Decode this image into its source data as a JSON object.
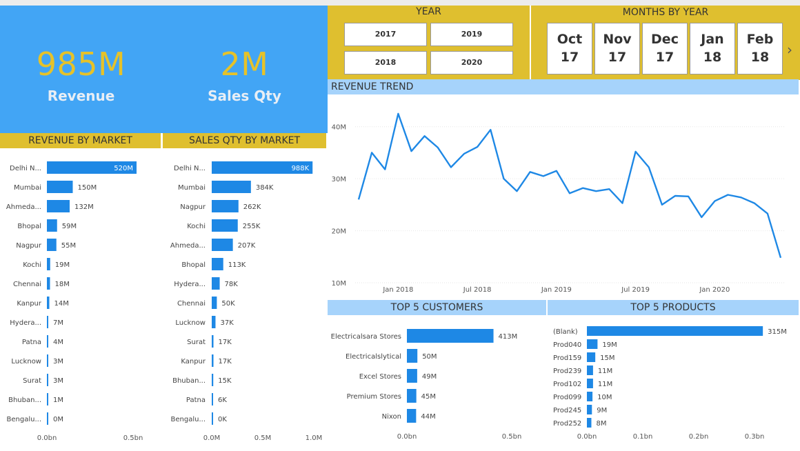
{
  "kpi": [
    {
      "value": "985M",
      "label": "Revenue"
    },
    {
      "value": "2M",
      "label": "Sales Qty"
    }
  ],
  "slicers": {
    "year_title": "YEAR",
    "years": [
      "2017",
      "2019",
      "2018",
      "2020"
    ],
    "months_title": "MONTHS BY YEAR",
    "months": [
      {
        "m": "Oct",
        "y": "17"
      },
      {
        "m": "Nov",
        "y": "17"
      },
      {
        "m": "Dec",
        "y": "17"
      },
      {
        "m": "Jan",
        "y": "18"
      },
      {
        "m": "Feb",
        "y": "18"
      }
    ],
    "next_icon": "chevron-right-icon"
  },
  "headers": {
    "revenue_by_market": "REVENUE BY MARKET",
    "sales_qty_by_market": "SALES QTY BY MARKET",
    "revenue_trend": "REVENUE TREND",
    "top5_customers": "TOP 5 CUSTOMERS",
    "top5_products": "TOP 5 PRODUCTS"
  },
  "colors": {
    "accent": "#42a5f5",
    "bar": "#1e88e5",
    "gold": "#dfbf2f",
    "kpi_value": "#e6c229",
    "header_blue": "#a6d3fb"
  },
  "chart_data": [
    {
      "id": "rev_market",
      "type": "bar",
      "orientation": "horizontal",
      "title": "REVENUE BY MARKET",
      "categories": [
        "Delhi N...",
        "Mumbai",
        "Ahmeda...",
        "Bhopal",
        "Nagpur",
        "Kochi",
        "Chennai",
        "Kanpur",
        "Hydera...",
        "Patna",
        "Lucknow",
        "Surat",
        "Bhuban...",
        "Bengalu..."
      ],
      "values": [
        520,
        150,
        132,
        59,
        55,
        19,
        18,
        14,
        7,
        4,
        3,
        3,
        1,
        0
      ],
      "labels": [
        "520M",
        "150M",
        "132M",
        "59M",
        "55M",
        "19M",
        "18M",
        "14M",
        "7M",
        "4M",
        "3M",
        "3M",
        "1M",
        "0M"
      ],
      "xlim": [
        0,
        500
      ],
      "xticks": [
        {
          "v": 0,
          "label": "0.0bn"
        },
        {
          "v": 500,
          "label": "0.5bn"
        }
      ]
    },
    {
      "id": "qty_market",
      "type": "bar",
      "orientation": "horizontal",
      "title": "SALES QTY BY MARKET",
      "categories": [
        "Delhi N...",
        "Mumbai",
        "Nagpur",
        "Kochi",
        "Ahmeda...",
        "Bhopal",
        "Hydera...",
        "Chennai",
        "Lucknow",
        "Surat",
        "Kanpur",
        "Bhuban...",
        "Patna",
        "Bengalu..."
      ],
      "values": [
        988,
        384,
        262,
        255,
        207,
        113,
        78,
        50,
        37,
        17,
        17,
        15,
        6,
        0
      ],
      "labels": [
        "988K",
        "384K",
        "262K",
        "255K",
        "207K",
        "113K",
        "78K",
        "50K",
        "37K",
        "17K",
        "17K",
        "15K",
        "6K",
        "0K"
      ],
      "xlim": [
        0,
        1000
      ],
      "xticks": [
        {
          "v": 0,
          "label": "0.0M"
        },
        {
          "v": 500,
          "label": "0.5M"
        },
        {
          "v": 1000,
          "label": "1.0M"
        }
      ]
    },
    {
      "id": "rev_trend",
      "type": "line",
      "title": "REVENUE TREND",
      "x": [
        "2017-10",
        "2017-11",
        "2017-12",
        "2018-01",
        "2018-02",
        "2018-03",
        "2018-04",
        "2018-05",
        "2018-06",
        "2018-07",
        "2018-08",
        "2018-09",
        "2018-10",
        "2018-11",
        "2018-12",
        "2019-01",
        "2019-02",
        "2019-03",
        "2019-04",
        "2019-05",
        "2019-06",
        "2019-07",
        "2019-08",
        "2019-09",
        "2019-10",
        "2019-11",
        "2019-12",
        "2020-01",
        "2020-02",
        "2020-03",
        "2020-04",
        "2020-05",
        "2020-06"
      ],
      "values": [
        26,
        35,
        31.8,
        42.5,
        35.3,
        38.2,
        36,
        32.2,
        34.8,
        36.1,
        39.4,
        30,
        27.6,
        31.3,
        30.5,
        31.5,
        27.2,
        28.2,
        27.6,
        28,
        25.3,
        35.2,
        32.2,
        25,
        26.7,
        26.6,
        22.6,
        25.7,
        26.9,
        26.4,
        25.3,
        23.3,
        14.8
      ],
      "ylim": [
        10,
        45
      ],
      "yticks": [
        {
          "v": 10,
          "label": "10M"
        },
        {
          "v": 20,
          "label": "20M"
        },
        {
          "v": 30,
          "label": "30M"
        },
        {
          "v": 40,
          "label": "40M"
        }
      ],
      "xticks": [
        {
          "v": "2018-01",
          "label": "Jan 2018"
        },
        {
          "v": "2018-07",
          "label": "Jul 2018"
        },
        {
          "v": "2019-01",
          "label": "Jan 2019"
        },
        {
          "v": "2019-07",
          "label": "Jul 2019"
        },
        {
          "v": "2020-01",
          "label": "Jan 2020"
        }
      ]
    },
    {
      "id": "top_customers",
      "type": "bar",
      "orientation": "horizontal",
      "title": "TOP 5 CUSTOMERS",
      "categories": [
        "Electricalsara Stores",
        "Electricalslytical",
        "Excel Stores",
        "Premium Stores",
        "Nixon"
      ],
      "values": [
        413,
        50,
        49,
        45,
        44
      ],
      "labels": [
        "413M",
        "50M",
        "49M",
        "45M",
        "44M"
      ],
      "xlim": [
        0,
        500
      ],
      "xticks": [
        {
          "v": 0,
          "label": "0.0bn"
        },
        {
          "v": 500,
          "label": "0.5bn"
        }
      ]
    },
    {
      "id": "top_products",
      "type": "bar",
      "orientation": "horizontal",
      "title": "TOP 5 PRODUCTS",
      "categories": [
        "(Blank)",
        "Prod040",
        "Prod159",
        "Prod239",
        "Prod102",
        "Prod099",
        "Prod245",
        "Prod252"
      ],
      "values": [
        315,
        19,
        15,
        11,
        11,
        10,
        9,
        8
      ],
      "labels": [
        "315M",
        "19M",
        "15M",
        "11M",
        "11M",
        "10M",
        "9M",
        "8M"
      ],
      "xlim": [
        0,
        300
      ],
      "xticks": [
        {
          "v": 0,
          "label": "0.0bn"
        },
        {
          "v": 100,
          "label": "0.1bn"
        },
        {
          "v": 200,
          "label": "0.2bn"
        },
        {
          "v": 300,
          "label": "0.3bn"
        }
      ]
    }
  ]
}
